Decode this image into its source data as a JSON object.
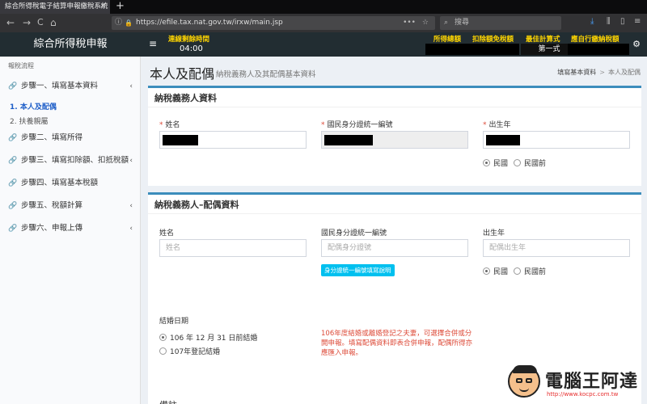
{
  "browser": {
    "tab_title": "綜合所得稅電子結算申報繳稅系統",
    "tab_close": "✕",
    "new_tab": "+",
    "url": "https://efile.tax.nat.gov.tw/irxw/main.jsp",
    "search_placeholder": "搜尋",
    "nav": {
      "back": "←",
      "forward": "→",
      "reload": "C",
      "home": "⌂"
    }
  },
  "header": {
    "brand": "綜合所得稅申報",
    "menu_icon": "≡",
    "timer_label": "連線剩餘時間",
    "timer_value": "04:00",
    "links": [
      "所得總額",
      "扣除額免稅額",
      "最佳計算式",
      "應自行繳納稅額"
    ],
    "best_method_value": "第一式",
    "settings_icon": "⚙"
  },
  "sidebar": {
    "heading": "報稅流程",
    "steps": [
      {
        "label": "步驟一、填寫基本資料",
        "has_children": true
      },
      {
        "label": "步驟二、填寫所得",
        "has_children": false
      },
      {
        "label": "步驟三、填寫扣除額、扣抵稅額",
        "has_children": true
      },
      {
        "label": "步驟四、填寫基本稅額",
        "has_children": false
      },
      {
        "label": "步驟五、稅額計算",
        "has_children": true
      },
      {
        "label": "步驟六、申報上傳",
        "has_children": true
      }
    ],
    "substeps": [
      {
        "label": "1. 本人及配偶",
        "active": true
      },
      {
        "label": "2. 扶養親屬",
        "active": false
      }
    ]
  },
  "page": {
    "title": "本人及配偶",
    "subtitle": "納稅義務人及其配偶基本資料",
    "breadcrumb": [
      "填寫基本資料",
      "本人及配偶"
    ],
    "breadcrumb_sep": ">"
  },
  "taxpayer": {
    "title": "納稅義務人資料",
    "name_label": "姓名",
    "id_label": "國民身分證統一編號",
    "birth_label": "出生年",
    "era_options": [
      "民國",
      "民國前"
    ],
    "era_selected": "民國"
  },
  "spouse": {
    "title": "納稅義務人–配偶資料",
    "name_label": "姓名",
    "name_placeholder": "姓名",
    "id_label": "國民身分證統一編號",
    "id_placeholder": "配偶身分證號",
    "id_help_button": "身分證統一編號填寫說明",
    "birth_label": "出生年",
    "birth_placeholder": "配偶出生年",
    "era_options": [
      "民國",
      "民國前"
    ],
    "era_selected": "民國",
    "marriage_label": "結婚日期",
    "marriage_options": [
      "106 年 12 月 31 日前結婚",
      "107年登記結婚"
    ],
    "marriage_selected": "106 年 12 月 31 日前結婚",
    "notice": "106年度結婚或離婚登記之夫妻，可選擇合併或分開申報。填寫配偶資料即表合併申報，配偶所得亦應匯入申報。"
  },
  "next_section_label": "備註",
  "watermark": {
    "name": "電腦王阿達",
    "url": "http://www.kocpc.com.tw"
  },
  "colors": {
    "accent": "#3c8dbc",
    "header_bg": "#222d32",
    "highlight": "#ffd600",
    "error": "#dd4b39",
    "info": "#00c0ef"
  }
}
